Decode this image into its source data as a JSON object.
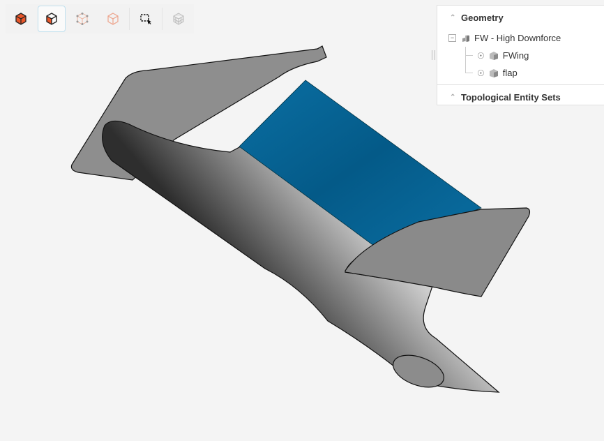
{
  "toolbar": {
    "buttons": [
      {
        "name": "solid-view-icon",
        "active": false
      },
      {
        "name": "solid-edges-view-icon",
        "active": true
      },
      {
        "name": "wireframe-points-icon",
        "active": false
      },
      {
        "name": "transparent-view-icon",
        "active": false
      },
      {
        "name": "box-select-icon",
        "active": false
      },
      {
        "name": "mesh-view-icon",
        "active": false
      }
    ]
  },
  "tree": {
    "geometry_label": "Geometry",
    "root_label": "FW - High Downforce",
    "root_expander": "−",
    "children": [
      {
        "label": "FWing"
      },
      {
        "label": "flap"
      }
    ],
    "topo_label": "Topological Entity Sets"
  },
  "colors": {
    "flap": "#05679a",
    "body": "#8a8a8a",
    "accent": "#e8562a"
  }
}
